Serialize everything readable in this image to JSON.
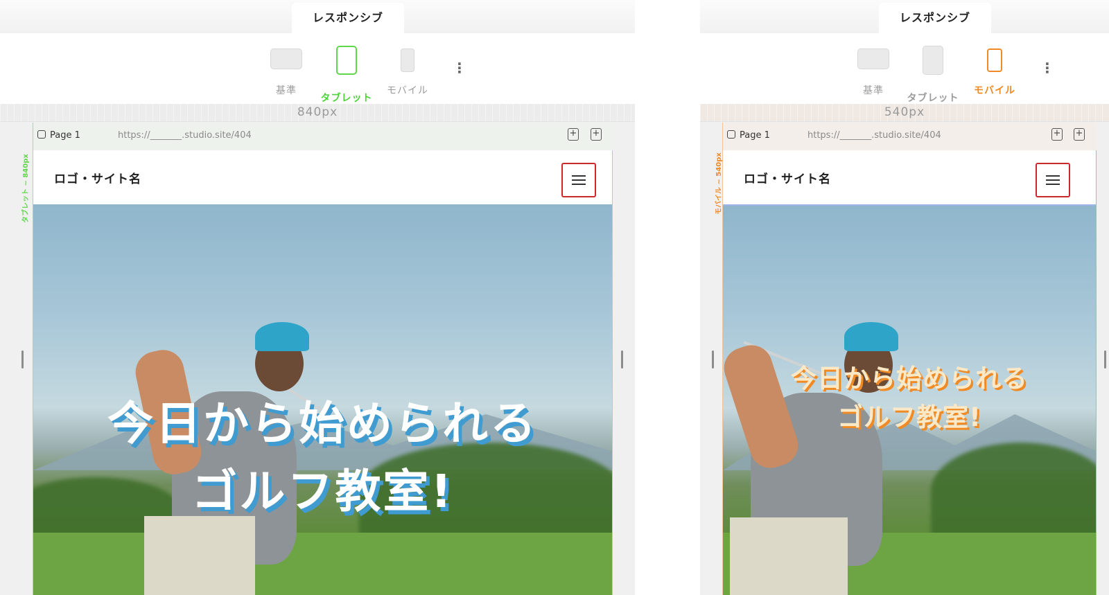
{
  "left": {
    "tab_label": "レスポンシブ",
    "devices": [
      {
        "label": "基準",
        "state": "normal"
      },
      {
        "label": "タブレット",
        "state": "active"
      },
      {
        "label": "モバイル",
        "state": "normal"
      }
    ],
    "ruler_text": "840px",
    "side_label": "タブレット ~ 840px",
    "page_name": "Page 1",
    "url": "https://_______.studio.site/404",
    "site": {
      "logo": "ロゴ・サイト名",
      "headline_line1": "今日から始められる",
      "headline_line2": "ゴルフ教室!"
    },
    "accent": "#5fd84a"
  },
  "right": {
    "tab_label": "レスポンシブ",
    "devices": [
      {
        "label": "基準",
        "state": "normal"
      },
      {
        "label": "タブレット",
        "state": "normal"
      },
      {
        "label": "モバイル",
        "state": "active"
      }
    ],
    "ruler_text": "540px",
    "side_label": "モバイル ~ 540px",
    "page_name": "Page 1",
    "url": "https://_______.studio.site/404",
    "site": {
      "logo": "ロゴ・サイト名",
      "headline_line1": "今日から始められる",
      "headline_line2": "ゴルフ教室!"
    },
    "accent": "#f08a24"
  },
  "icons": {
    "menu": "hamburger-icon",
    "more": "kebab-icon",
    "page": "page-icon",
    "add_page": "add-page-icon",
    "add": "add-icon"
  },
  "highlight_color": "#c9292b"
}
